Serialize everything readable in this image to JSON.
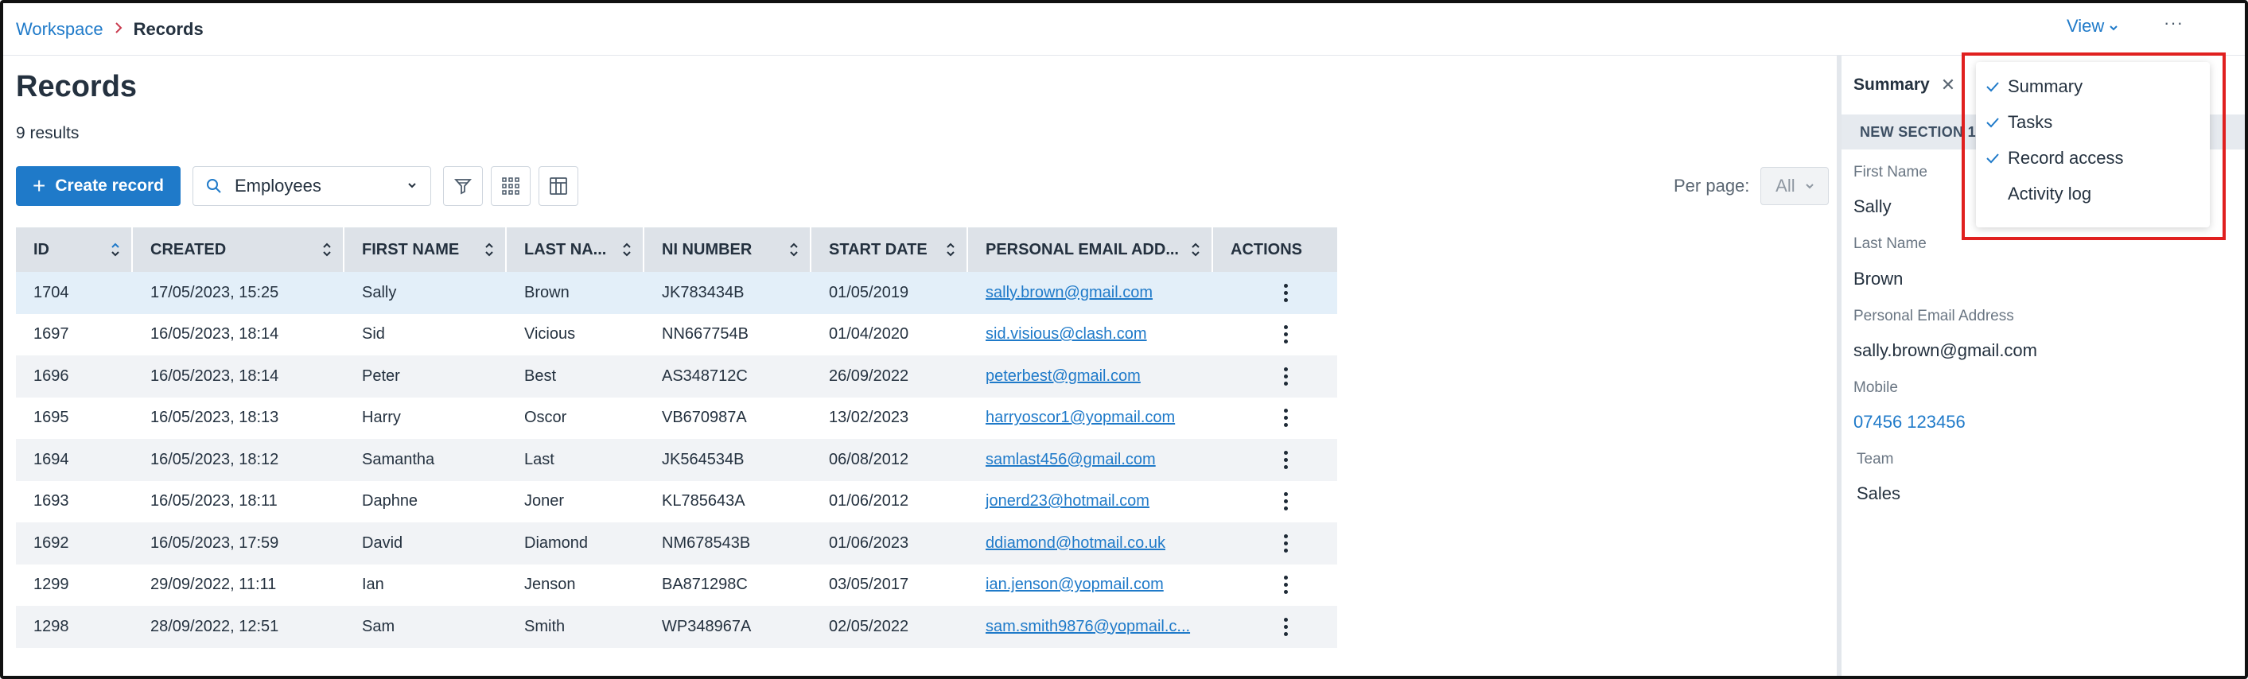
{
  "breadcrumb": {
    "root": "Workspace",
    "current": "Records"
  },
  "header": {
    "view_label": "View",
    "more_label": "···"
  },
  "page": {
    "title": "Records",
    "results": "9 results"
  },
  "toolbar": {
    "create_label": "Create record",
    "entity_value": "Employees",
    "per_page_label": "Per page:",
    "per_page_value": "All"
  },
  "table": {
    "columns": [
      "ID",
      "CREATED",
      "FIRST NAME",
      "LAST NA...",
      "NI NUMBER",
      "START DATE",
      "PERSONAL EMAIL ADD...",
      "ACTIONS"
    ],
    "rows": [
      {
        "id": "1704",
        "created": "17/05/2023, 15:25",
        "first": "Sally",
        "last": "Brown",
        "ni": "JK783434B",
        "start": "01/05/2019",
        "email": "sally.brown@gmail.com"
      },
      {
        "id": "1697",
        "created": "16/05/2023, 18:14",
        "first": "Sid",
        "last": "Vicious",
        "ni": "NN667754B",
        "start": "01/04/2020",
        "email": "sid.visious@clash.com"
      },
      {
        "id": "1696",
        "created": "16/05/2023, 18:14",
        "first": "Peter",
        "last": "Best",
        "ni": "AS348712C",
        "start": "26/09/2022",
        "email": "peterbest@gmail.com"
      },
      {
        "id": "1695",
        "created": "16/05/2023, 18:13",
        "first": "Harry",
        "last": "Oscor",
        "ni": "VB670987A",
        "start": "13/02/2023",
        "email": "harryoscor1@yopmail.com"
      },
      {
        "id": "1694",
        "created": "16/05/2023, 18:12",
        "first": "Samantha",
        "last": "Last",
        "ni": "JK564534B",
        "start": "06/08/2012",
        "email": "samlast456@gmail.com"
      },
      {
        "id": "1693",
        "created": "16/05/2023, 18:11",
        "first": "Daphne",
        "last": "Joner",
        "ni": "KL785643A",
        "start": "01/06/2012",
        "email": "jonerd23@hotmail.com"
      },
      {
        "id": "1692",
        "created": "16/05/2023, 17:59",
        "first": "David",
        "last": "Diamond",
        "ni": "NM678543B",
        "start": "01/06/2023",
        "email": "ddiamond@hotmail.co.uk"
      },
      {
        "id": "1299",
        "created": "29/09/2022, 11:11",
        "first": "Ian",
        "last": "Jenson",
        "ni": "BA871298C",
        "start": "03/05/2017",
        "email": "ian.jenson@yopmail.com"
      },
      {
        "id": "1298",
        "created": "28/09/2022, 12:51",
        "first": "Sam",
        "last": "Smith",
        "ni": "WP348967A",
        "start": "02/05/2022",
        "email": "sam.smith9876@yopmail.c..."
      }
    ]
  },
  "panel": {
    "tab_label": "Summary",
    "section_label": "NEW SECTION 1",
    "fields": [
      {
        "label": "First Name",
        "value": "Sally"
      },
      {
        "label": "Last Name",
        "value": "Brown"
      },
      {
        "label": "Personal Email Address",
        "value": "sally.brown@gmail.com"
      },
      {
        "label": "Mobile",
        "value": "07456 123456"
      },
      {
        "label": "Team",
        "value": "Sales"
      }
    ]
  },
  "view_menu": {
    "items": [
      {
        "label": "Summary",
        "checked": true
      },
      {
        "label": "Tasks",
        "checked": true
      },
      {
        "label": "Record access",
        "checked": true
      },
      {
        "label": "Activity log",
        "checked": false
      }
    ]
  },
  "colors": {
    "accent": "#1f7ac9",
    "highlight": "#e0201f",
    "selected_row": "#e3eff9",
    "header_bg": "#dde2e8"
  }
}
